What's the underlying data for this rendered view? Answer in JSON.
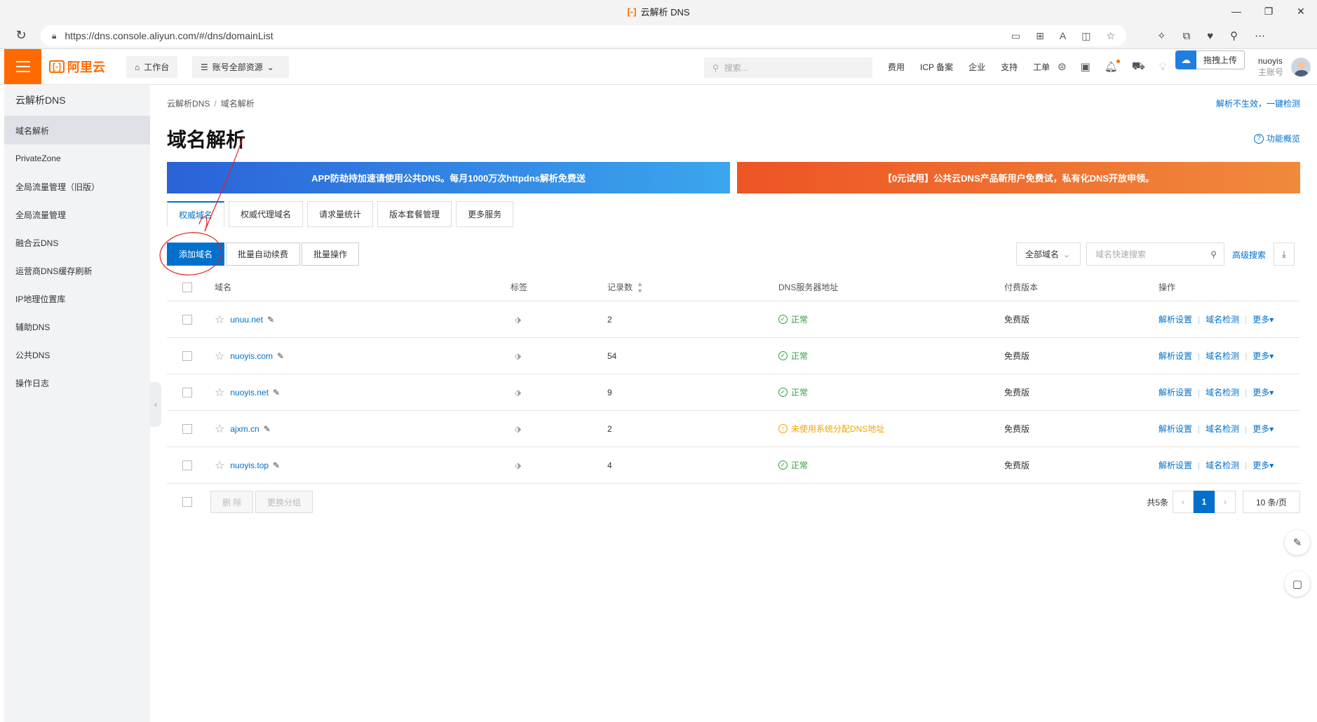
{
  "browser": {
    "tab_title": "云解析 DNS",
    "url": "https://dns.console.aliyun.com/#/dns/domainList"
  },
  "topnav": {
    "brand": "阿里云",
    "workbench": "工作台",
    "resources": "账号全部资源",
    "search_placeholder": "搜索...",
    "links": [
      "费用",
      "ICP 备案",
      "企业",
      "支持",
      "工单"
    ],
    "upload_label": "拖拽上传",
    "username": "nuoyis",
    "role": "主账号"
  },
  "sidebar": {
    "title": "云解析DNS",
    "items": [
      {
        "label": "域名解析",
        "active": true
      },
      {
        "label": "PrivateZone"
      },
      {
        "label": "全局流量管理（旧版）"
      },
      {
        "label": "全局流量管理"
      },
      {
        "label": "融合云DNS"
      },
      {
        "label": "运营商DNS缓存刷新"
      },
      {
        "label": "IP地理位置库"
      },
      {
        "label": "辅助DNS"
      },
      {
        "label": "公共DNS"
      },
      {
        "label": "操作日志"
      }
    ]
  },
  "breadcrumb": [
    "云解析DNS",
    "域名解析"
  ],
  "check_link": "解析不生效，一键检测",
  "page_title": "域名解析",
  "overview_link": "功能概览",
  "banners": {
    "blue": "APP防劫持加速请使用公共DNS。每月1000万次httpdns解析免费送",
    "orange": "【0元试用】公共云DNS产品新用户免费试，私有化DNS开放申领。"
  },
  "tabs": [
    "权威域名",
    "权威代理域名",
    "请求量统计",
    "版本套餐管理",
    "更多服务"
  ],
  "toolbar": {
    "add_domain": "添加域名",
    "batch_renew": "批量自动续费",
    "batch_ops": "批量操作",
    "filter": "全部域名",
    "search_placeholder": "域名快速搜索",
    "advanced_search": "高级搜索"
  },
  "table": {
    "columns": [
      "域名",
      "标签",
      "记录数",
      "DNS服务器地址",
      "付费版本",
      "操作"
    ],
    "rows": [
      {
        "domain": "unuu.net",
        "records": "2",
        "status": "正常",
        "status_type": "ok",
        "plan": "免费版"
      },
      {
        "domain": "nuoyis.com",
        "records": "54",
        "status": "正常",
        "status_type": "ok",
        "plan": "免费版"
      },
      {
        "domain": "nuoyis.net",
        "records": "9",
        "status": "正常",
        "status_type": "ok",
        "plan": "免费版"
      },
      {
        "domain": "ajxm.cn",
        "records": "2",
        "status": "未使用系统分配DNS地址",
        "status_type": "warn",
        "plan": "免费版"
      },
      {
        "domain": "nuoyis.top",
        "records": "4",
        "status": "正常",
        "status_type": "ok",
        "plan": "免费版"
      }
    ],
    "ops": [
      "解析设置",
      "域名检测",
      "更多▾"
    ]
  },
  "footer": {
    "delete": "删 除",
    "change_group": "更换分组",
    "total": "共5条",
    "current_page": "1",
    "page_size": "10 条/页"
  },
  "colors": {
    "brand": "#ff6a00",
    "primary": "#0070cc",
    "ok": "#2e9e3e",
    "warn": "#f0a400",
    "annotation": "#e02020"
  }
}
